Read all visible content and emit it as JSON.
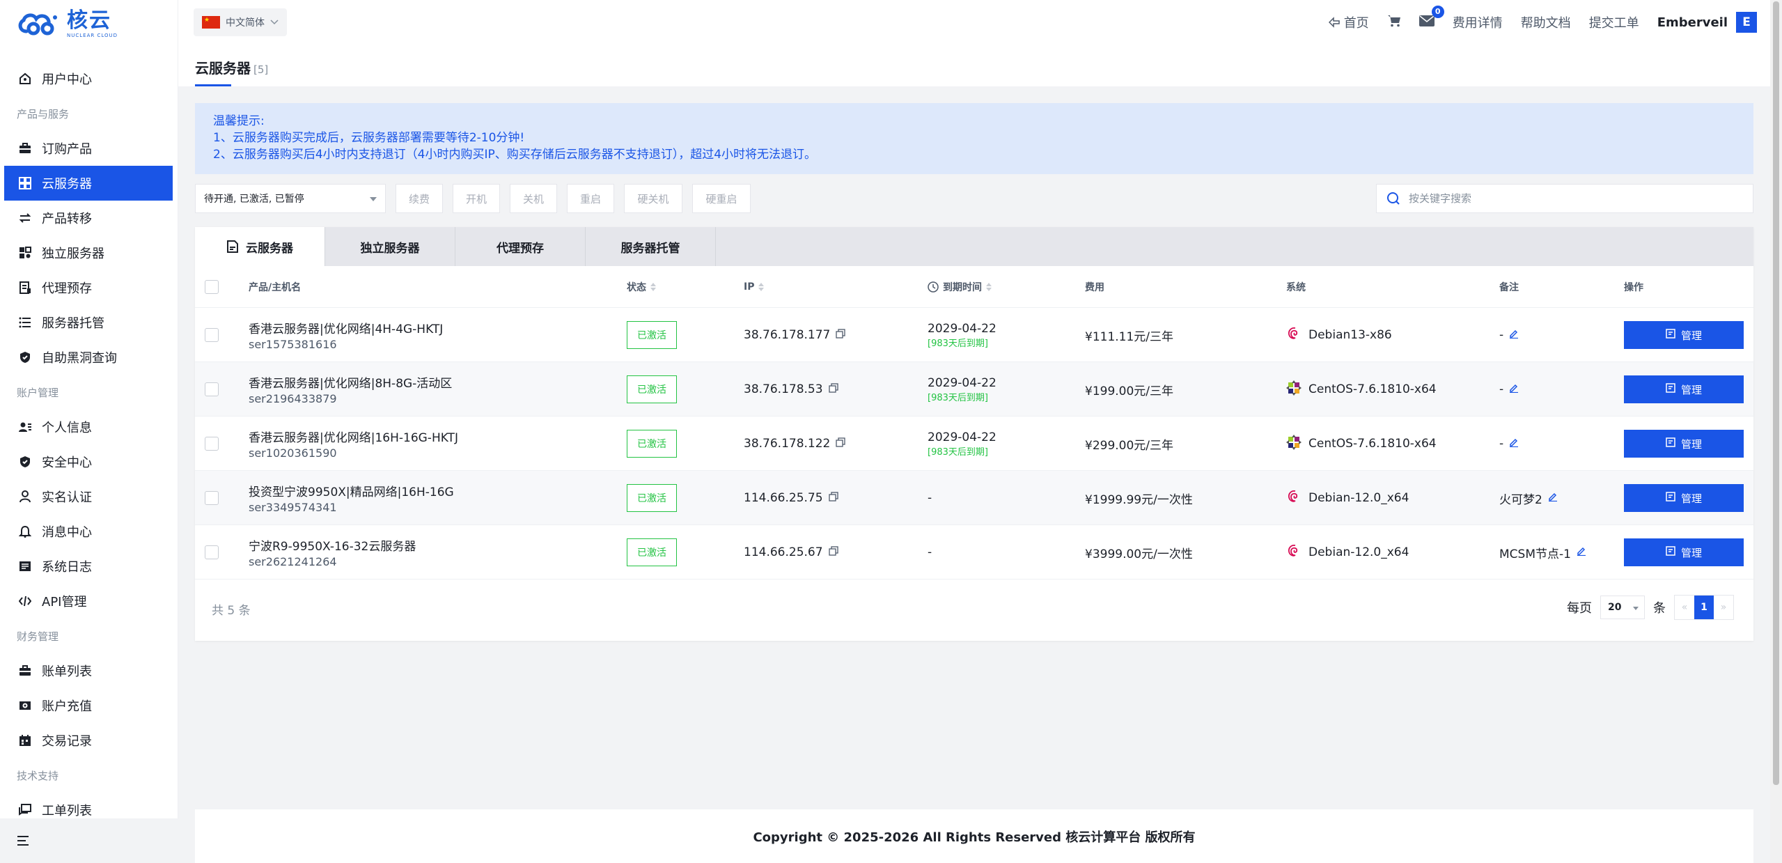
{
  "brand": {
    "name_cn": "核云",
    "name_en": "NUCLEAR CLOUD",
    "color": "#1a55e6"
  },
  "header": {
    "language": "中文简体",
    "links": {
      "home": "首页",
      "fees": "费用详情",
      "docs": "帮助文档",
      "ticket": "提交工单"
    },
    "message_count": "0",
    "username": "Emberveil",
    "avatar_letter": "E"
  },
  "sidebar": {
    "items": {
      "user_center": "用户中心",
      "group_products": "产品与服务",
      "order": "订购产品",
      "cloud": "云服务器",
      "transfer": "产品转移",
      "dedicated": "独立服务器",
      "proxy": "代理预存",
      "hosting": "服务器托管",
      "blacklist": "自助黑洞查询",
      "group_account": "账户管理",
      "profile": "个人信息",
      "security": "安全中心",
      "realname": "实名认证",
      "messages": "消息中心",
      "syslog": "系统日志",
      "api": "API管理",
      "group_finance": "财务管理",
      "bills": "账单列表",
      "recharge": "账户充值",
      "transactions": "交易记录",
      "group_support": "技术支持",
      "tickets": "工单列表"
    }
  },
  "page": {
    "title": "云服务器",
    "count": "[5]"
  },
  "notice": {
    "title": "温馨提示:",
    "line1": "1、云服务器购买完成后，云服务器部署需要等待2-10分钟!",
    "line2": "2、云服务器购买后4小时内支持退订（4小时内购买IP、购买存储后云服务器不支持退订），超过4小时将无法退订。"
  },
  "toolbar": {
    "status_filter": "待开通, 已激活, 已暂停",
    "renew": "续费",
    "start": "开机",
    "shutdown": "关机",
    "restart": "重启",
    "hard_shutdown": "硬关机",
    "hard_restart": "硬重启",
    "search_placeholder": "按关键字搜索"
  },
  "tabs": {
    "cloud": "云服务器",
    "dedicated": "独立服务器",
    "proxy": "代理预存",
    "hosting": "服务器托管"
  },
  "columns": {
    "product": "产品/主机名",
    "status": "状态",
    "ip": "IP",
    "expire": "到期时间",
    "fee": "费用",
    "os": "系统",
    "remark": "备注",
    "action": "操作"
  },
  "rows": [
    {
      "name": "香港云服务器|优化网络|4H-4G-HKTJ",
      "host": "ser1575381616",
      "status": "已激活",
      "ip": "38.76.178.177",
      "expire": "2029-04-22",
      "expire_note": "[983天后到期]",
      "fee": "¥111.11元/三年",
      "os": "Debian13-x86",
      "os_icon": "debian-icon",
      "remark": "-",
      "action": "管理"
    },
    {
      "name": "香港云服务器|优化网络|8H-8G-活动区",
      "host": "ser2196433879",
      "status": "已激活",
      "ip": "38.76.178.53",
      "expire": "2029-04-22",
      "expire_note": "[983天后到期]",
      "fee": "¥199.00元/三年",
      "os": "CentOS-7.6.1810-x64",
      "os_icon": "centos-icon",
      "remark": "-",
      "action": "管理"
    },
    {
      "name": "香港云服务器|优化网络|16H-16G-HKTJ",
      "host": "ser1020361590",
      "status": "已激活",
      "ip": "38.76.178.122",
      "expire": "2029-04-22",
      "expire_note": "[983天后到期]",
      "fee": "¥299.00元/三年",
      "os": "CentOS-7.6.1810-x64",
      "os_icon": "centos-icon",
      "remark": "-",
      "action": "管理"
    },
    {
      "name": "投资型宁波9950X|精品网络|16H-16G",
      "host": "ser3349574341",
      "status": "已激活",
      "ip": "114.66.25.75",
      "expire": "-",
      "expire_note": "",
      "fee": "¥1999.99元/一次性",
      "os": "Debian-12.0_x64",
      "os_icon": "debian-icon",
      "remark": "火可梦2",
      "action": "管理"
    },
    {
      "name": "宁波R9-9950X-16-32云服务器",
      "host": "ser2621241264",
      "status": "已激活",
      "ip": "114.66.25.67",
      "expire": "-",
      "expire_note": "",
      "fee": "¥3999.00元/一次性",
      "os": "Debian-12.0_x64",
      "os_icon": "debian-icon",
      "remark": "MCSM节点-1",
      "action": "管理"
    }
  ],
  "pagination": {
    "total": "共 5 条",
    "per_page_label": "每页",
    "per_page": "20",
    "unit": "条",
    "prev": "«",
    "current": "1",
    "next": "»"
  },
  "footer": {
    "copyright": "Copyright © 2025-2026 All Rights Reserved 核云计算平台 版权所有"
  }
}
